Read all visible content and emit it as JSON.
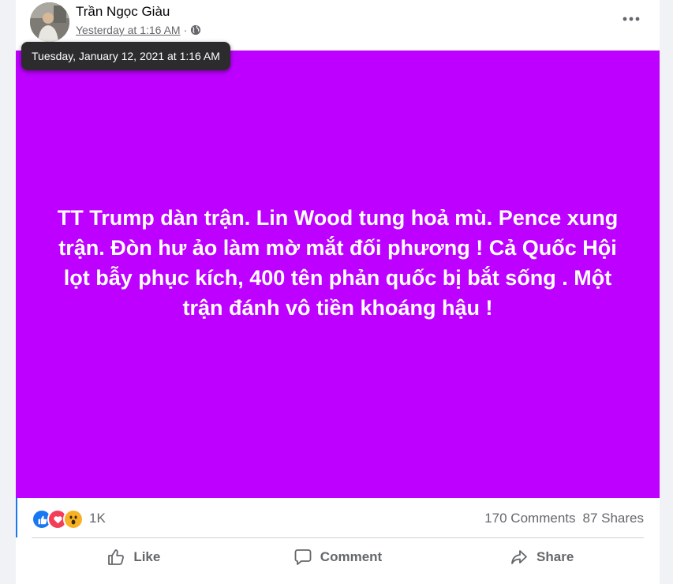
{
  "post": {
    "author": "Trần Ngọc Giàu",
    "timestamp": "Yesterday at 1:16 AM",
    "separator": "·",
    "privacy_icon": "globe-icon",
    "tooltip": "Tuesday, January 12, 2021 at 1:16 AM",
    "body": "TT Trump dàn trận. Lin Wood tung hoả mù. Pence xung trận. Đòn hư ảo làm mờ mắt đối phương ! Cả Quốc Hội lọt bẫy phục kích, 400 tên phản quốc bị bắt sống . Một trận đánh vô tiền khoáng hậu !",
    "background_color": "#bd00ff"
  },
  "stats": {
    "reaction_icons": [
      "like-icon",
      "love-icon",
      "wow-icon"
    ],
    "reaction_count": "1K",
    "comments": "170 Comments",
    "shares": "87 Shares"
  },
  "actions": {
    "like": "Like",
    "comment": "Comment",
    "share": "Share"
  },
  "colors": {
    "like_blue": "#1877f2",
    "love_red": "#f33e58",
    "wow_yellow": "#f7b125",
    "muted_text": "#65676b"
  }
}
